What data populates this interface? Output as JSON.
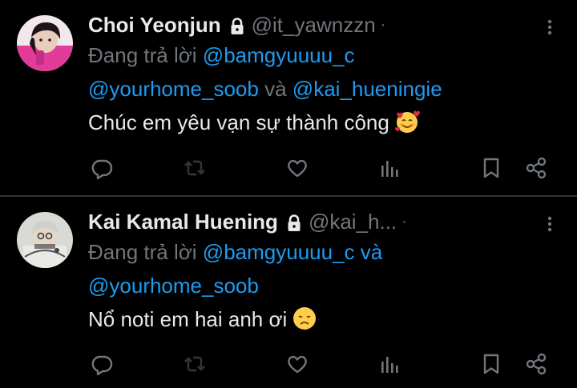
{
  "colors": {
    "background": "#000000",
    "text": "#e7e9ea",
    "muted": "#71767b",
    "mention": "#1d9bf0",
    "divider": "#2f3336"
  },
  "tweets": [
    {
      "display_name": "Choi Yeonjun",
      "handle": "@it_yawnzzn",
      "separator": "·",
      "reply_prefix": "Đang trả lời",
      "reply_mention_1": "@bamgyuuuu_c",
      "reply_mention_2": "@yourhome_soob",
      "reply_joiner": "và",
      "reply_mention_3": "@kai_hueningie",
      "text": "Chúc em yêu vạn sự thành công",
      "emoji": "smiling-face-with-hearts",
      "icons": [
        "lock-icon",
        "more-icon",
        "reply-icon",
        "retweet-icon",
        "like-icon",
        "views-icon",
        "bookmark-icon",
        "share-icon"
      ]
    },
    {
      "display_name": "Kai Kamal Huening",
      "handle": "@kai_h...",
      "separator": "·",
      "reply_prefix": "Đang trả lời",
      "reply_mention_1": "@bamgyuuuu_c",
      "reply_joiner": "và",
      "reply_mention_2": "@yourhome_soob",
      "text": "Nổ noti em hai anh ơi",
      "emoji": "disappointed-face",
      "icons": [
        "lock-icon",
        "more-icon",
        "reply-icon",
        "retweet-icon",
        "like-icon",
        "views-icon",
        "bookmark-icon",
        "share-icon"
      ]
    }
  ]
}
